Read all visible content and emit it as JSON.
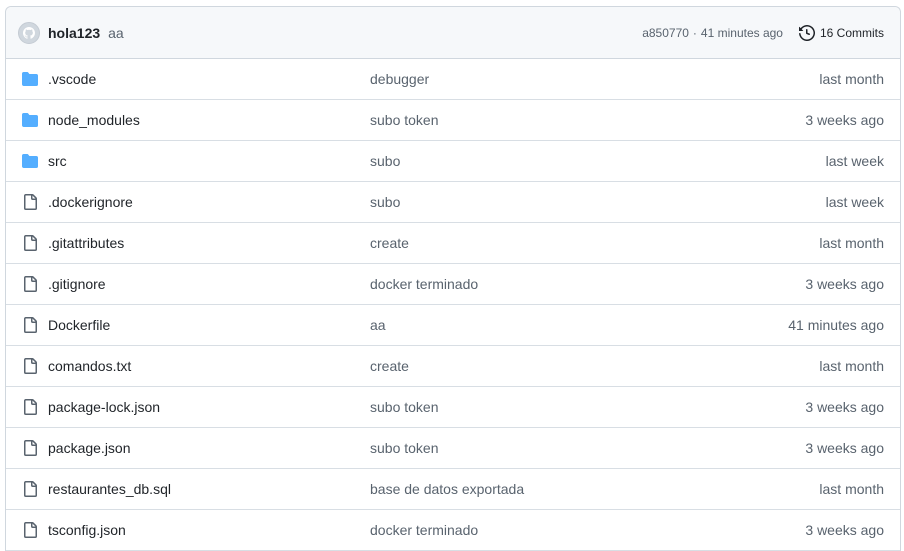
{
  "commit": {
    "author": "hola123",
    "message": "aa",
    "hash": "a850770",
    "separator": "·",
    "time": "41 minutes ago",
    "commits_label": "16 Commits"
  },
  "files": [
    {
      "type": "folder",
      "name": ".vscode",
      "message": "debugger",
      "date": "last month"
    },
    {
      "type": "folder",
      "name": "node_modules",
      "message": "subo token",
      "date": "3 weeks ago"
    },
    {
      "type": "folder",
      "name": "src",
      "message": "subo",
      "date": "last week"
    },
    {
      "type": "file",
      "name": ".dockerignore",
      "message": "subo",
      "date": "last week"
    },
    {
      "type": "file",
      "name": ".gitattributes",
      "message": "create",
      "date": "last month"
    },
    {
      "type": "file",
      "name": ".gitignore",
      "message": "docker terminado",
      "date": "3 weeks ago"
    },
    {
      "type": "file",
      "name": "Dockerfile",
      "message": "aa",
      "date": "41 minutes ago"
    },
    {
      "type": "file",
      "name": "comandos.txt",
      "message": "create",
      "date": "last month"
    },
    {
      "type": "file",
      "name": "package-lock.json",
      "message": "subo token",
      "date": "3 weeks ago"
    },
    {
      "type": "file",
      "name": "package.json",
      "message": "subo token",
      "date": "3 weeks ago"
    },
    {
      "type": "file",
      "name": "restaurantes_db.sql",
      "message": "base de datos exportada",
      "date": "last month"
    },
    {
      "type": "file",
      "name": "tsconfig.json",
      "message": "docker terminado",
      "date": "3 weeks ago"
    }
  ],
  "colors": {
    "folder": "#54aeff",
    "file_icon": "#59636e",
    "border": "#d0d7de",
    "header_bg": "#f6f8fa"
  }
}
